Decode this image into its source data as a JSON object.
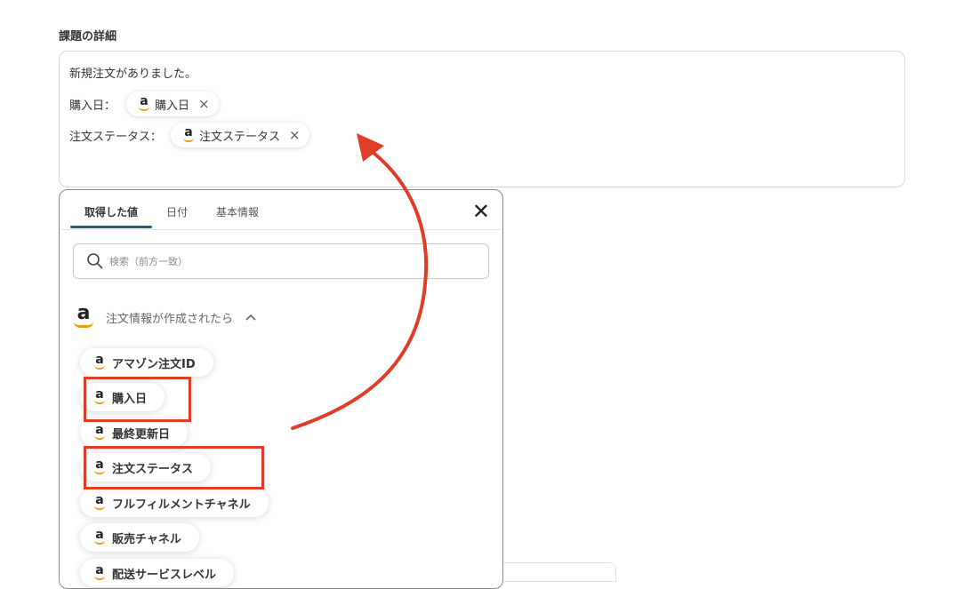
{
  "field": {
    "label": "課題の詳細",
    "line1": "新規注文がありました。",
    "line2_label": "購入日：",
    "line2_chip": "購入日",
    "line3_label": "注文ステータス：",
    "line3_chip": "注文ステータス"
  },
  "panel": {
    "tabs": [
      "取得した値",
      "日付",
      "基本情報"
    ],
    "active_tab": "取得した値",
    "search_placeholder": "検索（前方一致）",
    "section_title": "注文情報が作成されたら",
    "options": [
      "アマゾン注文ID",
      "購入日",
      "最終更新日",
      "注文ステータス",
      "フルフィルメントチャネル",
      "販売チャネル",
      "配送サービスレベル"
    ],
    "highlighted_options": [
      "購入日",
      "注文ステータス"
    ]
  },
  "icons": {
    "amazon_glyph": "a",
    "chip_remove": "×",
    "close": "✕",
    "search": "search-icon",
    "chevron": "chevron-up-icon"
  },
  "colors": {
    "accent": "#2d5b6e",
    "highlight": "#e03c28",
    "amazon_smile": "#f39a1b"
  }
}
